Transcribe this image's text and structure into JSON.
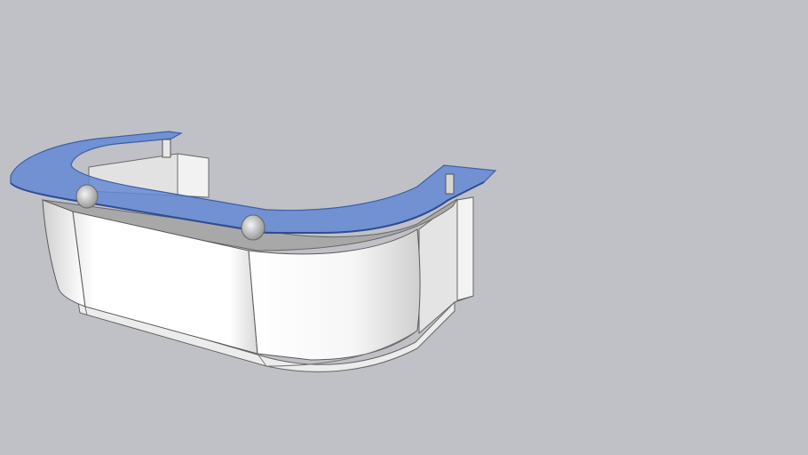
{
  "scene": {
    "subject": "reception-desk-model",
    "background_color": "#c0c0c7",
    "glass_color": "#5f86d4",
    "glass_edge_color": "#3d5fa6",
    "panel_color": "#ffffff",
    "panel_shade_color": "#dcdcdc",
    "inner_panel_color": "#e6e6e6",
    "trim_color": "#9d9d9d",
    "outline_color": "#5a5a5a"
  }
}
